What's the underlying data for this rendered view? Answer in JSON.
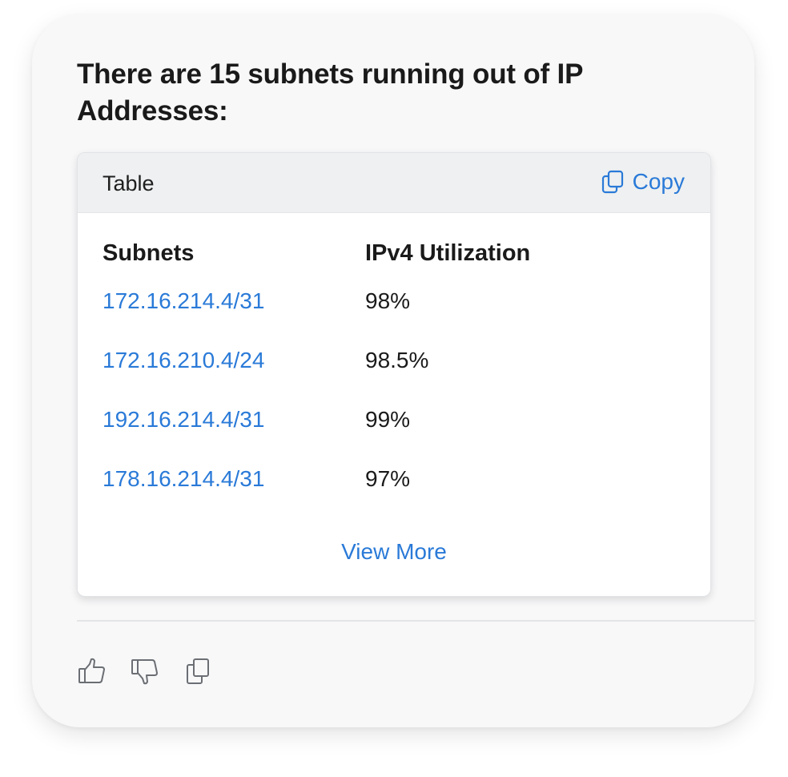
{
  "message": {
    "heading": "There are 15 subnets running out of IP Addresses:"
  },
  "table_panel": {
    "title": "Table",
    "copy_label": "Copy",
    "columns": [
      "Subnets",
      "IPv4 Utilization"
    ],
    "rows": [
      {
        "subnet": "172.16.214.4/31",
        "utilization": "98%"
      },
      {
        "subnet": "172.16.210.4/24",
        "utilization": "98.5%"
      },
      {
        "subnet": "192.16.214.4/31",
        "utilization": "99%"
      },
      {
        "subnet": "178.16.214.4/31",
        "utilization": "97%"
      }
    ],
    "view_more_label": "View More"
  },
  "feedback": {
    "icons": [
      "thumbs-up-icon",
      "thumbs-down-icon",
      "copy-icon"
    ]
  },
  "colors": {
    "link": "#2a7ad8",
    "text": "#1a1a1a",
    "header_bg": "#eef0f1",
    "card_bg": "#f8f8f9",
    "icon_gray": "#6b6f74"
  }
}
